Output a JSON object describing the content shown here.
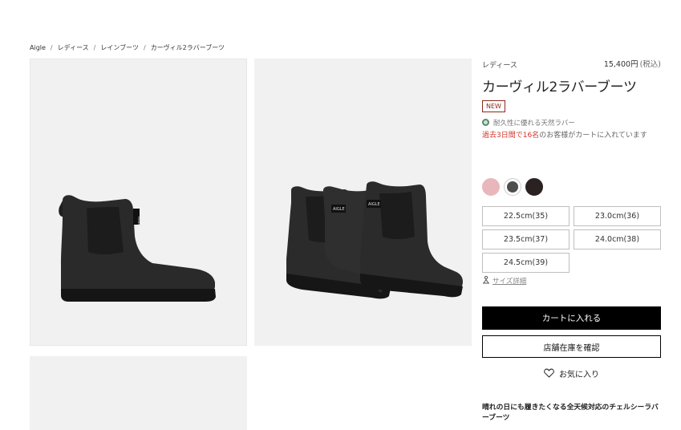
{
  "breadcrumb": [
    "Aigle",
    "レディース",
    "レインブーツ",
    "カーヴィル2ラバーブーツ"
  ],
  "breadcrumb_separator": "/",
  "product": {
    "category": "レディース",
    "price": "15,400円",
    "price_tax": "(税込)",
    "title": "カーヴィル2ラバーブーツ",
    "badge": "NEW",
    "feature": "耐久性に優れる天然ラバー",
    "viewers_highlight": "過去3日間で16名",
    "viewers_rest": "のお客様がカートに入れています",
    "colors": [
      {
        "name": "pink",
        "hex": "#e9b7bb"
      },
      {
        "name": "gray",
        "hex": "#4e4e4e"
      },
      {
        "name": "black",
        "hex": "#2a2220"
      }
    ],
    "sizes": [
      "22.5cm(35)",
      "23.0cm(36)",
      "23.5cm(37)",
      "24.0cm(38)",
      "24.5cm(39)"
    ],
    "size_guide": "サイズ詳細",
    "add_to_cart": "カートに入れる",
    "check_store": "店舗在庫を確認",
    "favorite": "お気に入り",
    "description": "晴れの日にも履きたくなる全天候対応のチェルシーラバーブーツ"
  },
  "images": {
    "boot_label": "AIGLE"
  }
}
